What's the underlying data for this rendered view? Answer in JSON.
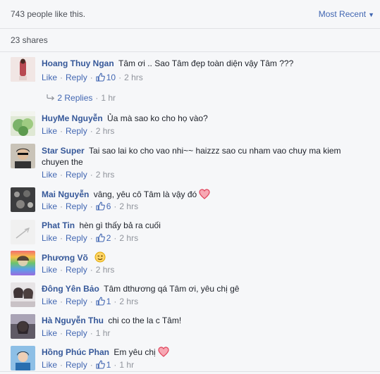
{
  "header": {
    "likes_count": "743",
    "likes_text": "people like this.",
    "sort_label": "Most Recent",
    "shares_label": "23 shares"
  },
  "labels": {
    "like": "Like",
    "reply": "Reply"
  },
  "comments": [
    {
      "author": "Hoang Thuy Ngan",
      "text": "Tâm ơi .. Sao Tâm đẹp toàn diện vậy Tâm ???",
      "likes": "10",
      "time": "2 hrs",
      "replies": "2 Replies",
      "replies_time": "1 hr"
    },
    {
      "author": "HuyMe Nguyễn",
      "text": "Ủa mà sao ko cho họ vào?",
      "time": "2 hrs"
    },
    {
      "author": "Star Super",
      "text": "Tai sao lai ko cho vao nhi~~ haizzz sao cu nham vao chuy ma kiem chuyen the",
      "time": "2 hrs"
    },
    {
      "author": "Mai Nguyễn",
      "text": "vâng, yêu cô Tâm là vậy đó",
      "likes": "6",
      "time": "2 hrs",
      "emoji": "heart-icon"
    },
    {
      "author": "Phat Tin",
      "text": "hèn gì thấy bả ra cuối",
      "likes": "2",
      "time": "2 hrs"
    },
    {
      "author": "Phương Võ",
      "text": "",
      "time": "2 hrs",
      "emoji": "wink-face-icon"
    },
    {
      "author": "Đông Yên Bảo",
      "text": "Tâm dthương qá Tâm ơi, yêu chị gê",
      "likes": "1",
      "time": "2 hrs"
    },
    {
      "author": "Hà Nguyễn Thu",
      "text": "chi co the la c Tâm!",
      "time": "1 hr"
    },
    {
      "author": "Hồng Phúc Phan",
      "text": "Em yêu chị",
      "likes": "1",
      "time": "1 hr",
      "emoji": "heart-icon"
    }
  ],
  "colors": {
    "link": "#4267b2",
    "author": "#365899",
    "meta": "#90949c",
    "background": "#f6f7f9",
    "heart": "#f25268"
  }
}
